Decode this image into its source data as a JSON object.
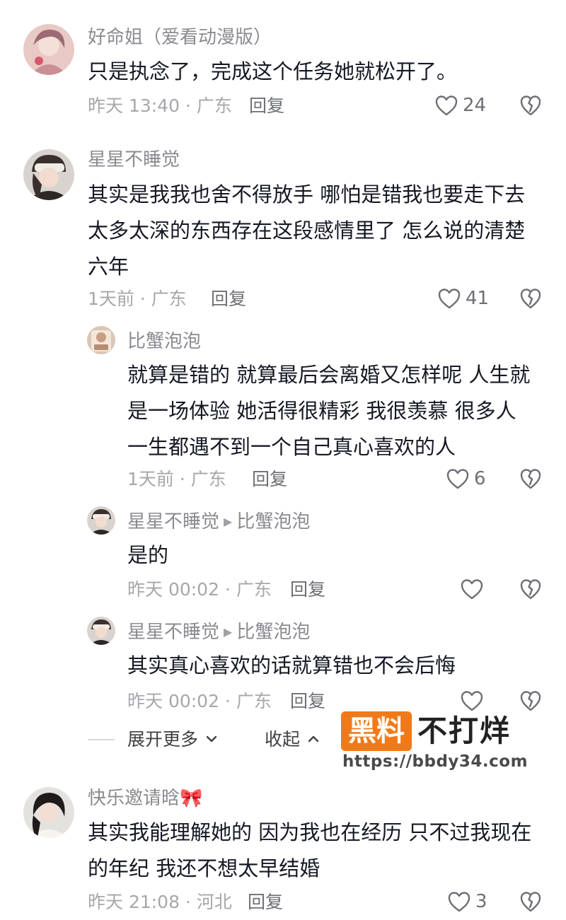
{
  "comments": [
    {
      "name": "好命姐（爱看动漫版）",
      "lines": [
        "只是执念了，完成这个任务她就松开了。"
      ],
      "time": "昨天 13:40 · 广东",
      "reply": "回复",
      "likes": "24"
    },
    {
      "name": "星星不睡觉",
      "lines": [
        "其实是我我也舍不得放手 哪怕是错我也要走下去",
        "太多太深的东西存在这段感情里了 怎么说的清楚",
        "六年"
      ],
      "time": "1天前 · 广东",
      "reply": "回复",
      "likes": "41",
      "replies": [
        {
          "name": "比蟹泡泡",
          "lines": [
            "就算是错的 就算最后会离婚又怎样呢 人生就",
            "是一场体验 她活得很精彩 我很羡慕 很多人",
            "一生都遇不到一个自己真心喜欢的人"
          ],
          "time": "1天前 · 广东",
          "reply": "回复",
          "likes": "6"
        },
        {
          "name": "星星不睡觉",
          "reply_to": "比蟹泡泡",
          "lines": [
            "是的"
          ],
          "time": "昨天 00:02 · 广东",
          "reply": "回复"
        },
        {
          "name": "星星不睡觉",
          "reply_to": "比蟹泡泡",
          "lines": [
            "其实真心喜欢的话就算错也不会后悔"
          ],
          "time": "昨天 00:02 · 广东",
          "reply": "回复"
        }
      ],
      "expand_label": "展开更多",
      "collapse_label": "收起"
    },
    {
      "name": "快乐邀请晗🎀",
      "lines": [
        "其实我能理解她的 因为我也在经历 只不过我现在",
        "的年纪 我还不想太早结婚"
      ],
      "time": "昨天 21:08 · 河北",
      "reply": "回复",
      "likes": "3"
    }
  ],
  "watermark": {
    "badge": "黑料",
    "text": "不打烊",
    "url": "https://bbdy34.com"
  },
  "colors": {
    "text_primary": "#161823",
    "text_secondary": "#8a8b91",
    "watermark_orange": "#f07a19"
  },
  "icons": [
    "heart-outline-icon",
    "broken-heart-icon",
    "chevron-down-icon",
    "chevron-up-icon",
    "play-triangle-icon"
  ]
}
